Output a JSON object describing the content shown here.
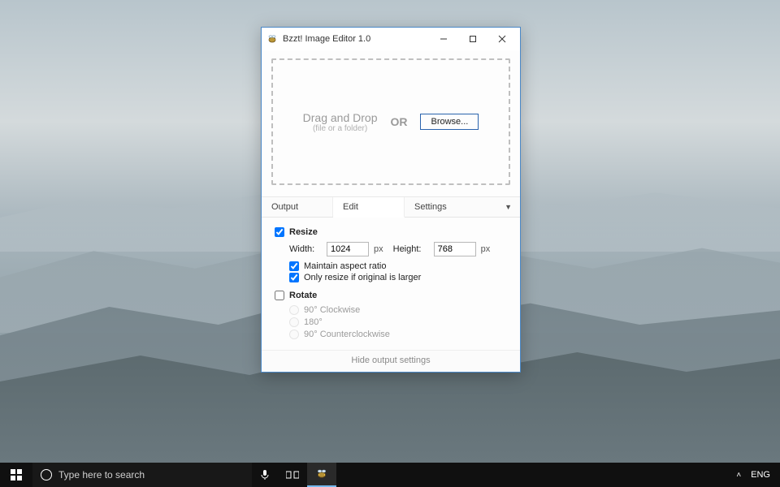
{
  "window": {
    "title": "Bzzt! Image Editor 1.0",
    "dropzone": {
      "main": "Drag and Drop",
      "sub": "(file or a folder)",
      "or": "OR",
      "browse": "Browse..."
    },
    "tabs": {
      "output": "Output",
      "edit": "Edit",
      "settings": "Settings"
    },
    "resize": {
      "label": "Resize",
      "checked": true,
      "width_label": "Width:",
      "width_value": "1024",
      "height_label": "Height:",
      "height_value": "768",
      "unit": "px",
      "maintain_ratio": {
        "label": "Maintain aspect ratio",
        "checked": true
      },
      "only_if_larger": {
        "label": "Only resize if original is larger",
        "checked": true
      }
    },
    "rotate": {
      "label": "Rotate",
      "checked": false,
      "options": [
        {
          "label": "90° Clockwise"
        },
        {
          "label": "180°"
        },
        {
          "label": "90° Counterclockwise"
        }
      ]
    },
    "footer": "Hide output settings"
  },
  "taskbar": {
    "search_placeholder": "Type here to search",
    "lang": "ENG"
  }
}
